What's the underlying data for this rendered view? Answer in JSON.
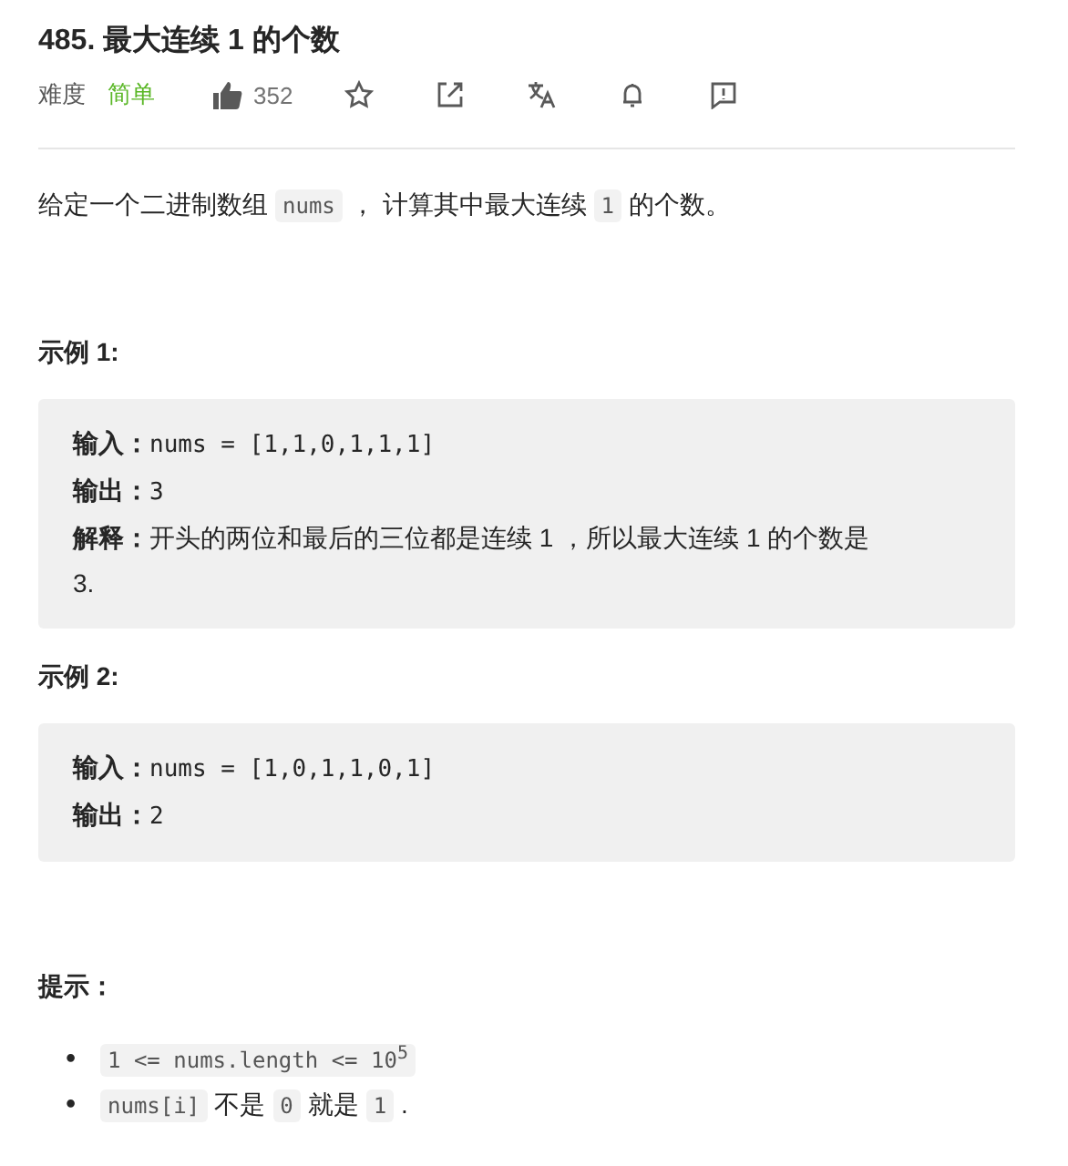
{
  "title": "485. 最大连续 1 的个数",
  "meta": {
    "difficulty_label": "难度",
    "difficulty": "简单",
    "likes": "352"
  },
  "description": [
    {
      "kind": "text",
      "text": "给定一个二进制数组"
    },
    {
      "kind": "code",
      "text": "nums"
    },
    {
      "kind": "text",
      "text": "， 计算其中最大连续"
    },
    {
      "kind": "code",
      "text": "1"
    },
    {
      "kind": "text",
      "text": "的个数。"
    }
  ],
  "examples": [
    {
      "heading": "示例 1:",
      "lines": [
        {
          "label": "输入：",
          "value": "nums = [1,1,0,1,1,1]"
        },
        {
          "label": "输出：",
          "value": "3"
        },
        {
          "label": "解释：",
          "value": "开头的两位和最后的三位都是连续 1 ，所以最大连续 1 的个数是 3."
        }
      ]
    },
    {
      "heading": "示例 2:",
      "lines": [
        {
          "label": "输入：",
          "value": "nums = [1,0,1,1,0,1]"
        },
        {
          "label": "输出：",
          "value": "2"
        }
      ]
    }
  ],
  "hints": {
    "heading": "提示：",
    "items": [
      {
        "bullet": "•",
        "parts": [
          {
            "kind": "code",
            "text": "1 <= nums.length <= 10$^{5}$"
          }
        ]
      },
      {
        "bullet": "•",
        "parts": [
          {
            "kind": "code",
            "text": "nums[i]"
          },
          {
            "kind": "text",
            "text": "不是"
          },
          {
            "kind": "code",
            "text": "0"
          },
          {
            "kind": "text",
            "text": "就是"
          },
          {
            "kind": "code",
            "text": "1"
          },
          {
            "kind": "text",
            "text": "."
          }
        ]
      }
    ]
  }
}
